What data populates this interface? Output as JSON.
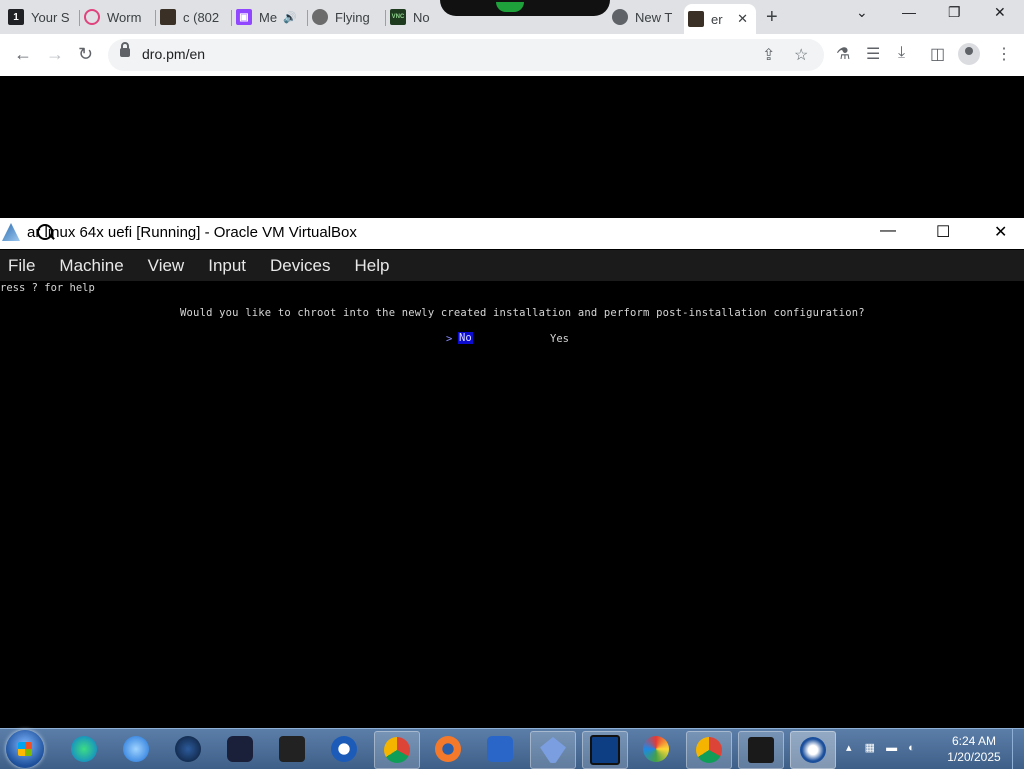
{
  "browser": {
    "tabs": [
      {
        "label": "Your S",
        "badge": "1"
      },
      {
        "label": "Worm",
        "badge": ""
      },
      {
        "label": "c (802",
        "badge": ""
      },
      {
        "label": "Me",
        "badge": ""
      },
      {
        "label": "Flying",
        "badge": ""
      },
      {
        "label": "No",
        "badge": "VNC"
      },
      {
        "label": "New T",
        "badge": ""
      },
      {
        "label": "er",
        "badge": ""
      }
    ],
    "url": "dro.pm/en"
  },
  "vbox": {
    "title": "ar linux 64x uefi [Running] - Oracle VM VirtualBox",
    "menu": [
      "File",
      "Machine",
      "View",
      "Input",
      "Devices",
      "Help"
    ],
    "console": {
      "help": "ress ? for help",
      "question": "Would you like to chroot into the newly created installation and perform post-installation configuration?",
      "selector": ">",
      "option_no": "No",
      "option_yes": "Yes"
    }
  },
  "taskbar": {
    "clock_time": "6:24 AM",
    "clock_date": "1/20/2025"
  }
}
